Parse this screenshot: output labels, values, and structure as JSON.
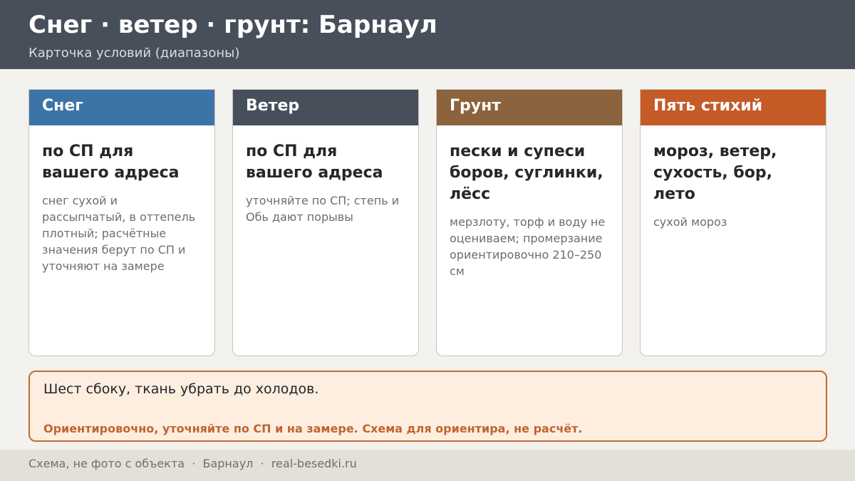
{
  "header": {
    "title": "Снег · ветер · грунт: Барнаул",
    "subtitle": "Карточка условий (диапазоны)"
  },
  "colors": {
    "snow": "#3d74a8",
    "wind": "#474f5b",
    "soil": "#8b633c",
    "elements": "#c55b27",
    "notice_border": "#bf6a34",
    "notice_bg": "#fdeee0"
  },
  "cards": [
    {
      "head": "Снег",
      "main": "по СП для вашего адреса",
      "note": "снег сухой и рассыпчатый, в оттепель плотный; расчётные значения берут по СП и уточняют на замере"
    },
    {
      "head": "Ветер",
      "main": "по СП для вашего адреса",
      "note": "уточняйте по СП; степь и Обь дают порывы"
    },
    {
      "head": "Грунт",
      "main": "пески и супеси боров, суглинки, лёсс",
      "note": "мерзлоту, торф и воду не оцениваем; промерзание ориентировочно 210–250 см"
    },
    {
      "head": "Пять стихий",
      "main": "мороз, ветер, сухость, бор, лето",
      "note": "сухой мороз"
    }
  ],
  "notice": {
    "text": "Шест сбоку, ткань убрать до холодов.",
    "warning": "Ориентировочно, уточняйте по СП и на замере. Схема для ориентира, не расчёт."
  },
  "footer": {
    "text": "Схема, не фото с объекта  ·  Барнаул  ·  real-besedki.ru"
  }
}
